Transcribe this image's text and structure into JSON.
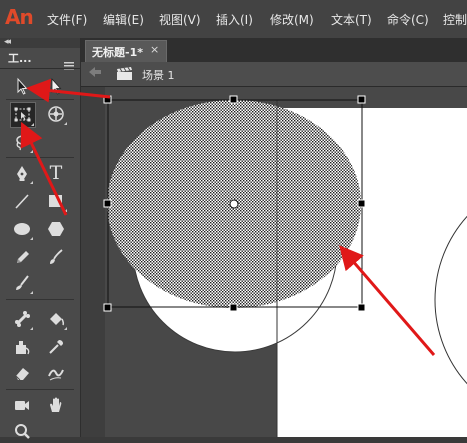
{
  "app": {
    "logo_text": "An",
    "brand_color": "#e04a2a"
  },
  "menu": {
    "items": [
      "文件(F)",
      "编辑(E)",
      "视图(V)",
      "插入(I)",
      "修改(M)",
      "文本(T)",
      "命令(C)",
      "控制"
    ]
  },
  "tool_panel": {
    "title": "工..."
  },
  "tools": [
    {
      "name": "selection-tool-icon"
    },
    {
      "name": "subselection-tool-icon"
    },
    {
      "name": "free-transform-tool-icon",
      "active": true
    },
    {
      "name": "3d-rotation-tool-icon"
    },
    {
      "name": "lasso-tool-icon"
    },
    {
      "name": "pen-tool-icon"
    },
    {
      "name": "text-tool-icon",
      "glyph": "T"
    },
    {
      "name": "line-tool-icon"
    },
    {
      "name": "rectangle-tool-icon"
    },
    {
      "name": "oval-tool-icon"
    },
    {
      "name": "polystar-tool-icon"
    },
    {
      "name": "pencil-tool-icon"
    },
    {
      "name": "paint-brush-tool-icon"
    },
    {
      "name": "brush-tool-icon"
    },
    {
      "name": "bone-tool-icon"
    },
    {
      "name": "paint-bucket-tool-icon"
    },
    {
      "name": "ink-bottle-tool-icon"
    },
    {
      "name": "eyedropper-tool-icon"
    },
    {
      "name": "eraser-tool-icon"
    },
    {
      "name": "width-tool-icon"
    },
    {
      "name": "camera-tool-icon"
    },
    {
      "name": "hand-tool-icon"
    },
    {
      "name": "zoom-tool-icon"
    }
  ],
  "document": {
    "tab_title": "无标题-1*",
    "tab_close": "×",
    "back_icon": "back-arrow-icon",
    "scene_icon": "scene-clapper-icon",
    "scene_label": "场景 1"
  },
  "colors": {
    "annotation_arrow": "#e01818",
    "stage_white": "#ffffff",
    "pasteboard_gray": "#484848"
  }
}
